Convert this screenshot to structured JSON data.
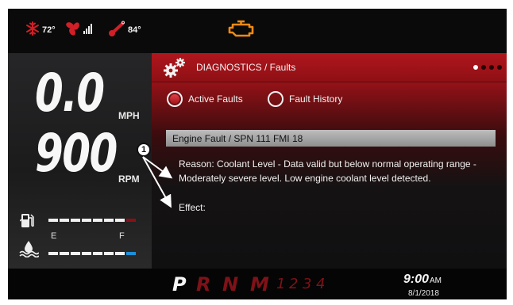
{
  "status": {
    "ac_temp": "72°",
    "outside_temp": "84°",
    "icons": [
      "snowflake-icon",
      "fan-icon",
      "signal-bars-icon",
      "thermometer-icon",
      "check-engine-icon"
    ],
    "colors": {
      "red": "#d11f28",
      "engine_warning": "#f08a12"
    }
  },
  "speed": {
    "value": "0.0",
    "unit": "MPH"
  },
  "rpm": {
    "value": "900",
    "unit": "RPM"
  },
  "fuel_gauge": {
    "icon": "fuel-pump-icon",
    "empty_label": "E",
    "full_label": "F",
    "low_color": "#8b1016"
  },
  "coolant_gauge": {
    "icon": "coolant-level-icon",
    "accent_color": "#1e90d8"
  },
  "panel": {
    "title": "DIAGNOSTICS / Faults",
    "page_indicator": {
      "total": 4,
      "current": 1
    },
    "tabs": [
      {
        "label": "Active Faults",
        "selected": true
      },
      {
        "label": "Fault History",
        "selected": false
      }
    ],
    "fault": {
      "title": "Engine Fault / SPN 111 FMI 18",
      "reason": "Reason: Coolant Level - Data valid but below normal operating range - Moderately severe level.  Low engine coolant level detected.",
      "effect": "Effect:"
    }
  },
  "callout": {
    "number": "1"
  },
  "transmission": {
    "gears": [
      "P",
      "R",
      "N",
      "M"
    ],
    "active": "P",
    "manual_gears": [
      "1",
      "2",
      "3",
      "4"
    ]
  },
  "clock": {
    "time": "9:00",
    "ampm": "AM",
    "date": "8/1/2018"
  }
}
